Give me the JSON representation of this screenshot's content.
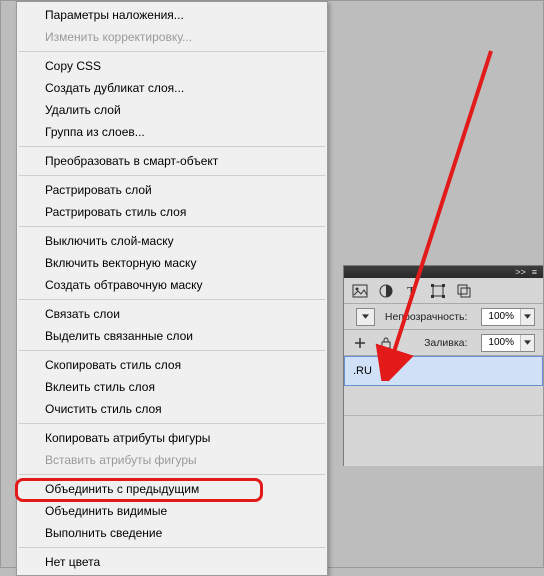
{
  "menu": {
    "items": [
      {
        "label": "Параметры наложения...",
        "disabled": false,
        "sep": false
      },
      {
        "label": "Изменить корректировку...",
        "disabled": true,
        "sep": true
      },
      {
        "label": "Copy CSS",
        "disabled": false,
        "sep": false
      },
      {
        "label": "Создать дубликат слоя...",
        "disabled": false,
        "sep": false
      },
      {
        "label": "Удалить слой",
        "disabled": false,
        "sep": false
      },
      {
        "label": "Группа из слоев...",
        "disabled": false,
        "sep": true
      },
      {
        "label": "Преобразовать в смарт-объект",
        "disabled": false,
        "sep": true
      },
      {
        "label": "Растрировать слой",
        "disabled": false,
        "sep": false
      },
      {
        "label": "Растрировать стиль слоя",
        "disabled": false,
        "sep": true
      },
      {
        "label": "Выключить слой-маску",
        "disabled": false,
        "sep": false
      },
      {
        "label": "Включить векторную маску",
        "disabled": false,
        "sep": false
      },
      {
        "label": "Создать обтравочную маску",
        "disabled": false,
        "sep": true
      },
      {
        "label": "Связать слои",
        "disabled": false,
        "sep": false
      },
      {
        "label": "Выделить связанные слои",
        "disabled": false,
        "sep": true
      },
      {
        "label": "Скопировать стиль слоя",
        "disabled": false,
        "sep": false
      },
      {
        "label": "Вклеить стиль слоя",
        "disabled": false,
        "sep": false
      },
      {
        "label": "Очистить стиль слоя",
        "disabled": false,
        "sep": true
      },
      {
        "label": "Копировать атрибуты фигуры",
        "disabled": false,
        "sep": false
      },
      {
        "label": "Вставить атрибуты фигуры",
        "disabled": true,
        "sep": true
      },
      {
        "label": "Объединить с предыдущим",
        "disabled": false,
        "sep": false,
        "highlight": true
      },
      {
        "label": "Объединить видимые",
        "disabled": false,
        "sep": false
      },
      {
        "label": "Выполнить сведение",
        "disabled": false,
        "sep": true
      },
      {
        "label": "Нет цвета",
        "disabled": false,
        "sep": false
      }
    ]
  },
  "panels": {
    "opacity_label": "Непрозрачность:",
    "fill_label": "Заливка:",
    "opacity_value": "100%",
    "fill_value": "100%",
    "tabs_icons": [
      ">>",
      "≡"
    ],
    "layer_selected_text": ".RU"
  },
  "annotation": {
    "arrow_color": "#e21a1a"
  }
}
